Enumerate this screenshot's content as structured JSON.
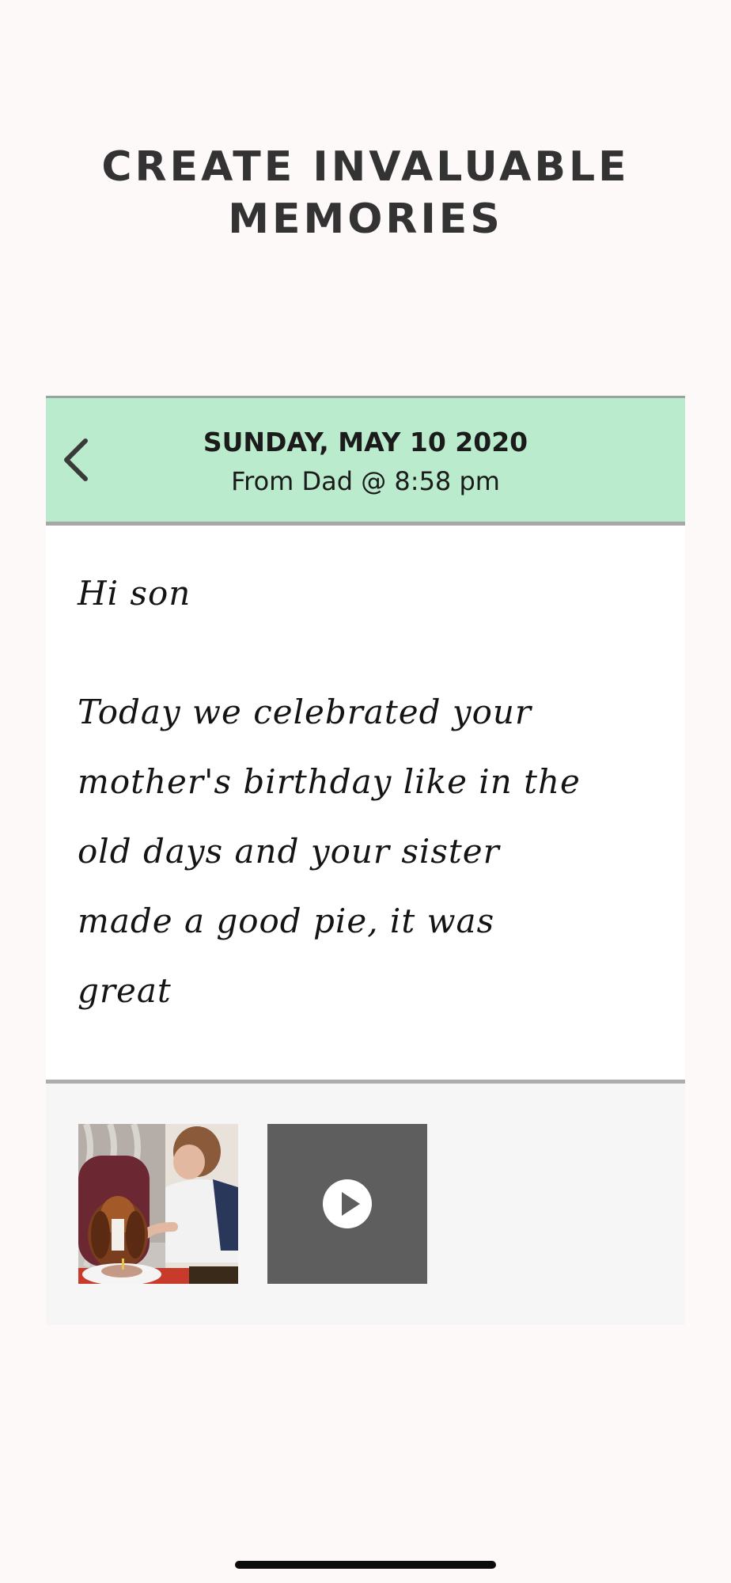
{
  "headline": {
    "line1": "CREATE INVALUABLE",
    "line2": "MEMORIES"
  },
  "card": {
    "header": {
      "back_icon": "chevron-left-icon",
      "date": "SUNDAY, MAY 10 2020",
      "from_line": "From Dad @ 8:58 pm",
      "background_color": "#b9ebcc"
    },
    "message": {
      "greeting": "Hi son",
      "lines": [
        "Today we celebrated your",
        "mother's birthday like in the",
        "old days and your sister",
        "made a good pie, it was",
        "great"
      ]
    },
    "attachments": [
      {
        "type": "photo",
        "icon": "photo-thumbnail"
      },
      {
        "type": "video",
        "icon": "play-icon"
      }
    ]
  }
}
